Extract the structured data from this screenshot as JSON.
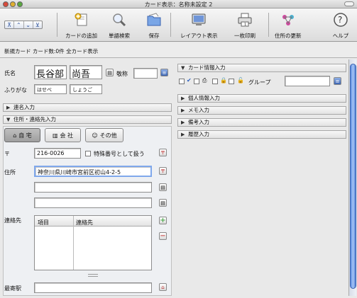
{
  "window": {
    "title": "カード表示：名称未設定 2"
  },
  "toolbar": {
    "nav": [
      "⊼",
      "⌃",
      "⌄",
      "⊻"
    ],
    "items": [
      {
        "label": "カードの追加",
        "icon": "add-card-icon"
      },
      {
        "label": "単語検索",
        "icon": "magnifier-icon"
      },
      {
        "label": "保存",
        "icon": "folder-save-icon"
      },
      {
        "label": "レイアウト表示",
        "icon": "monitor-icon"
      },
      {
        "label": "一枚印刷",
        "icon": "printer-icon"
      },
      {
        "label": "住所の更新",
        "icon": "address-update-icon"
      },
      {
        "label": "ヘルプ",
        "icon": "help-icon"
      }
    ]
  },
  "status": {
    "text": "新規カード カード数:0件 全カード表示"
  },
  "name": {
    "label": "氏名",
    "last": "長谷部",
    "first": "尚吾",
    "honorific_label": "敬称",
    "honorific_value": "",
    "furigana_label": "ふりがな",
    "furigana_last": "はせべ",
    "furigana_first": "しょうご"
  },
  "sections": {
    "renmei": "連名入力",
    "address_contact": "住所・連絡先入力",
    "card_info": "カード情報入力",
    "personal": "個人情報入力",
    "memo": "メモ入力",
    "remarks": "備考入力",
    "history": "履歴入力"
  },
  "tabs": [
    "自 宅",
    "会 社",
    "その他"
  ],
  "address": {
    "postal_symbol": "〒",
    "postal_code": "216-0026",
    "special_label": "特殊番号として扱う",
    "address_label": "住所",
    "line1": "神奈川県川崎市宮前区初山4-2-5",
    "line2": "",
    "line3": ""
  },
  "contact": {
    "label": "連絡先",
    "columns": [
      "項目",
      "連絡先"
    ]
  },
  "station": {
    "label": "最寄駅",
    "value": ""
  },
  "card_info": {
    "group_label": "グループ",
    "group_value": ""
  },
  "colors": {
    "accent": "#3a63b0",
    "scroll": "#5b8ce0"
  }
}
